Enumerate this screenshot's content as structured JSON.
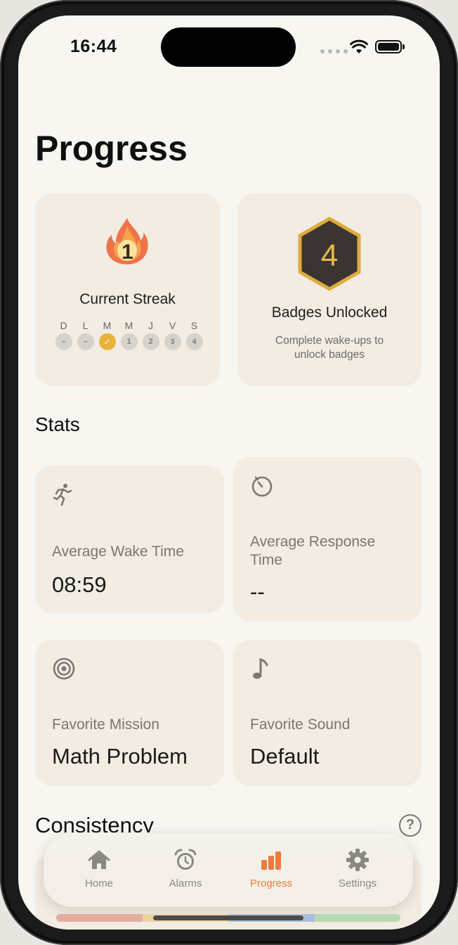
{
  "status_bar": {
    "time": "16:44"
  },
  "page": {
    "title": "Progress"
  },
  "streak": {
    "count": "1",
    "label": "Current Streak",
    "days": [
      {
        "letter": "D",
        "mark": "–",
        "state": "missed"
      },
      {
        "letter": "L",
        "mark": "–",
        "state": "missed"
      },
      {
        "letter": "M",
        "mark": "✓",
        "state": "done"
      },
      {
        "letter": "M",
        "mark": "1",
        "state": "upcoming"
      },
      {
        "letter": "J",
        "mark": "2",
        "state": "upcoming"
      },
      {
        "letter": "V",
        "mark": "3",
        "state": "upcoming"
      },
      {
        "letter": "S",
        "mark": "4",
        "state": "upcoming"
      }
    ]
  },
  "badges": {
    "count": "4",
    "title": "Badges Unlocked",
    "subtitle": "Complete wake-ups to unlock badges"
  },
  "stats": {
    "title": "Stats",
    "items": [
      {
        "icon": "running-icon",
        "label": "Average Wake Time",
        "value": "08:59"
      },
      {
        "icon": "timer-icon",
        "label": "Average Response Time",
        "value": "--"
      },
      {
        "icon": "target-icon",
        "label": "Favorite Mission",
        "value": "Math Problem"
      },
      {
        "icon": "music-note-icon",
        "label": "Favorite Sound",
        "value": "Default"
      }
    ]
  },
  "consistency": {
    "title": "Consistency",
    "help_icon": "question-icon",
    "help_glyph": "?"
  },
  "tabbar": {
    "items": [
      {
        "label": "Home",
        "icon": "house-icon",
        "active": false
      },
      {
        "label": "Alarms",
        "icon": "alarm-clock-icon",
        "active": false
      },
      {
        "label": "Progress",
        "icon": "bar-chart-icon",
        "active": true
      },
      {
        "label": "Settings",
        "icon": "gear-icon",
        "active": false
      }
    ]
  },
  "colors": {
    "background": "#f8f6f1",
    "card": "#f2ece2",
    "accent": "#ec7b3f",
    "streak_done": "#e9b23b",
    "badge_gold": "#e8b64b",
    "badge_dark": "#3a3532",
    "strip": [
      "#e3aea0",
      "#ecd3a1",
      "#a9bfdc",
      "#b8d9b1"
    ]
  }
}
